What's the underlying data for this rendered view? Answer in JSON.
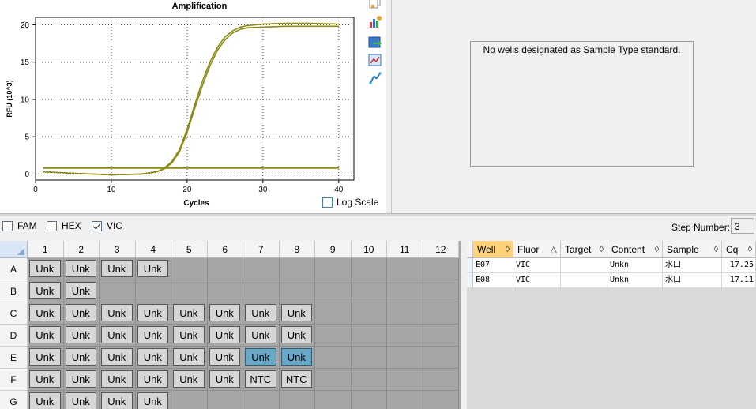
{
  "chart": {
    "title": "Amplification",
    "xlabel": "Cycles",
    "ylabel": "RFU (10^3)",
    "log_scale_label": "Log Scale",
    "log_scale_checked": false
  },
  "chart_data": {
    "type": "line",
    "title": "Amplification",
    "xlabel": "Cycles",
    "ylabel": "RFU (10^3)",
    "xlim": [
      0,
      42
    ],
    "ylim": [
      -0.8,
      21
    ],
    "x_ticks": [
      0,
      10,
      20,
      30,
      40
    ],
    "y_ticks": [
      0,
      5,
      10,
      15,
      20
    ],
    "grid": true,
    "series": [
      {
        "x": [
          1,
          5,
          10,
          14,
          16,
          17,
          18,
          19,
          20,
          21,
          22,
          23,
          24,
          25,
          26,
          27,
          28,
          30,
          33,
          36,
          40
        ],
        "values": [
          0.3,
          0.1,
          -0.1,
          0.0,
          0.3,
          0.7,
          1.5,
          3.0,
          5.6,
          8.8,
          11.8,
          14.5,
          16.6,
          18.0,
          18.9,
          19.4,
          19.6,
          19.7,
          19.8,
          19.8,
          19.8
        ]
      },
      {
        "x": [
          1,
          5,
          10,
          14,
          16,
          17,
          18,
          19,
          20,
          21,
          22,
          23,
          24,
          25,
          26,
          27,
          28,
          30,
          33,
          36,
          40
        ],
        "values": [
          0.3,
          0.1,
          -0.1,
          0.0,
          0.3,
          0.8,
          1.7,
          3.3,
          6.0,
          9.3,
          12.4,
          15.0,
          17.0,
          18.4,
          19.2,
          19.7,
          19.9,
          20.1,
          20.2,
          20.2,
          20.1
        ]
      },
      {
        "x": [
          1,
          40
        ],
        "values": [
          0.8,
          0.8
        ]
      },
      {
        "x": [
          1,
          40
        ],
        "values": [
          0.85,
          0.85
        ]
      }
    ],
    "line_color": "#8a8a16"
  },
  "toolbar": {
    "icons": [
      "copy-icon",
      "chart-settings-icon",
      "export-icon",
      "zoom-icon",
      "curve-icon"
    ]
  },
  "standard_panel": {
    "message": "No wells designated as Sample Type standard."
  },
  "fluors": [
    {
      "label": "FAM",
      "checked": false
    },
    {
      "label": "HEX",
      "checked": false
    },
    {
      "label": "VIC",
      "checked": true
    }
  ],
  "step": {
    "label": "Step Number:",
    "value": "3"
  },
  "plate": {
    "columns": [
      "1",
      "2",
      "3",
      "4",
      "5",
      "6",
      "7",
      "8",
      "9",
      "10",
      "11",
      "12"
    ],
    "rows": [
      {
        "label": "A",
        "wells": [
          "Unk",
          "Unk",
          "Unk",
          "Unk",
          "",
          "",
          "",
          "",
          "",
          "",
          "",
          ""
        ]
      },
      {
        "label": "B",
        "wells": [
          "Unk",
          "Unk",
          "",
          "",
          "",
          "",
          "",
          "",
          "",
          "",
          "",
          ""
        ]
      },
      {
        "label": "C",
        "wells": [
          "Unk",
          "Unk",
          "Unk",
          "Unk",
          "Unk",
          "Unk",
          "Unk",
          "Unk",
          "",
          "",
          "",
          ""
        ]
      },
      {
        "label": "D",
        "wells": [
          "Unk",
          "Unk",
          "Unk",
          "Unk",
          "Unk",
          "Unk",
          "Unk",
          "Unk",
          "",
          "",
          "",
          ""
        ]
      },
      {
        "label": "E",
        "wells": [
          "Unk",
          "Unk",
          "Unk",
          "Unk",
          "Unk",
          "Unk",
          "Unk",
          "Unk",
          "",
          "",
          "",
          ""
        ],
        "selected": [
          6,
          7
        ]
      },
      {
        "label": "F",
        "wells": [
          "Unk",
          "Unk",
          "Unk",
          "Unk",
          "Unk",
          "Unk",
          "NTC",
          "NTC",
          "",
          "",
          "",
          ""
        ]
      },
      {
        "label": "G",
        "wells": [
          "Unk",
          "Unk",
          "Unk",
          "Unk",
          "",
          "",
          "",
          "",
          "",
          "",
          "",
          ""
        ]
      }
    ],
    "selected_color": "#68a7c6"
  },
  "results": {
    "headers": [
      "Well",
      "Fluor",
      "Target",
      "Content",
      "Sample",
      "Cq"
    ],
    "sort_glyphs": [
      "◊",
      "△",
      "◊",
      "◊",
      "◊",
      "◊"
    ],
    "rows": [
      {
        "well": "E07",
        "fluor": "VIC",
        "target": "",
        "content": "Unkn",
        "sample": "水口",
        "cq": "17.25"
      },
      {
        "well": "E08",
        "fluor": "VIC",
        "target": "",
        "content": "Unkn",
        "sample": "水口",
        "cq": "17.11"
      }
    ],
    "active_header_color": "#ffd27a"
  }
}
